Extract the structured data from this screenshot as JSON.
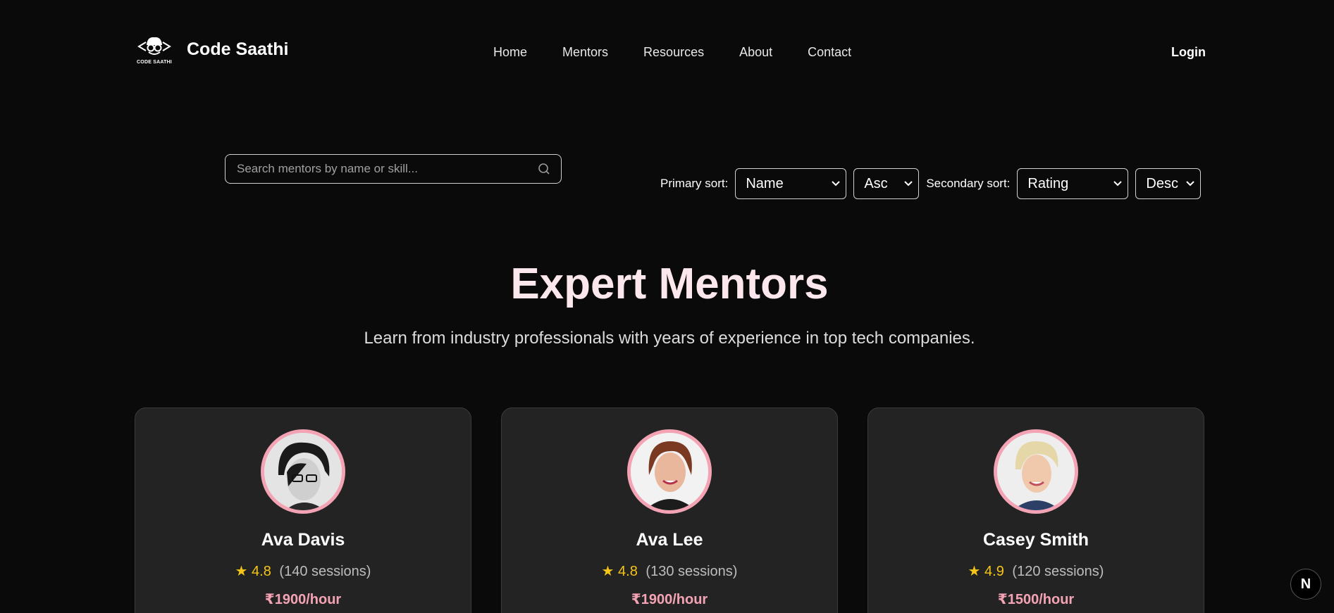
{
  "header": {
    "logo_text": "CODE SAATHI",
    "brand": "Code Saathi",
    "nav": [
      "Home",
      "Mentors",
      "Resources",
      "About",
      "Contact"
    ],
    "login": "Login"
  },
  "search": {
    "placeholder": "Search mentors by name or skill...",
    "value": ""
  },
  "sort": {
    "primary_label": "Primary sort:",
    "primary_field": "Name",
    "primary_order": "Asc",
    "secondary_label": "Secondary sort:",
    "secondary_field": "Rating",
    "secondary_order": "Desc"
  },
  "hero": {
    "title": "Expert Mentors",
    "subtitle": "Learn from industry professionals with years of experience in top tech companies."
  },
  "mentors": [
    {
      "name": "Ava Davis",
      "star": "★",
      "rating": "4.8",
      "sessions": "(140 sessions)",
      "price": "₹1900/hour"
    },
    {
      "name": "Ava Lee",
      "star": "★",
      "rating": "4.8",
      "sessions": "(130 sessions)",
      "price": "₹1900/hour"
    },
    {
      "name": "Casey Smith",
      "star": "★",
      "rating": "4.9",
      "sessions": "(120 sessions)",
      "price": "₹1500/hour"
    }
  ],
  "dev_badge": "N",
  "colors": {
    "background": "#0a0a0a",
    "card": "#232323",
    "accent_pink": "#f4a3b4",
    "star": "#f5c518",
    "title": "#fce8ec"
  }
}
